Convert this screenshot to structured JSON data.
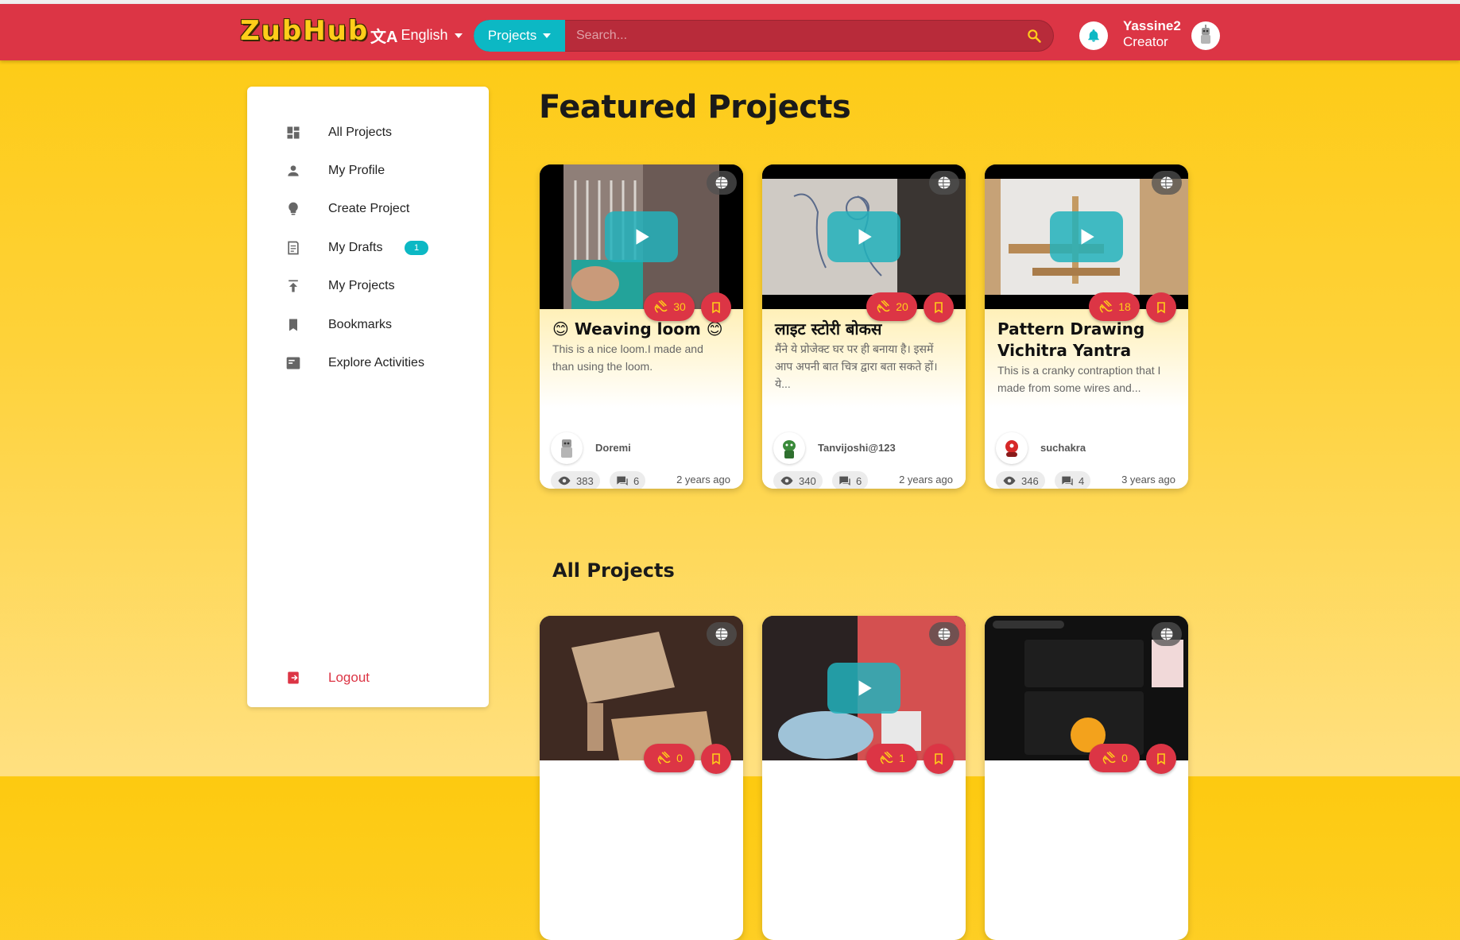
{
  "header": {
    "logo_text": "ZubHub",
    "language_label": "English",
    "search_category": "Projects",
    "search_placeholder": "Search...",
    "user_name": "Yassine2",
    "user_role": "Creator"
  },
  "sidebar": {
    "items": [
      {
        "label": "All Projects",
        "icon": "dashboard-icon"
      },
      {
        "label": "My Profile",
        "icon": "person-icon"
      },
      {
        "label": "Create Project",
        "icon": "lightbulb-icon"
      },
      {
        "label": "My Drafts",
        "icon": "drafts-icon",
        "badge": "1"
      },
      {
        "label": "My Projects",
        "icon": "publish-icon"
      },
      {
        "label": "Bookmarks",
        "icon": "bookmark-icon"
      },
      {
        "label": "Explore Activities",
        "icon": "activities-icon"
      }
    ],
    "logout_label": "Logout"
  },
  "main": {
    "featured_heading": "Featured Projects",
    "all_heading": "All Projects",
    "featured": [
      {
        "title": "😊 Weaving loom 😊",
        "description": "This is a nice loom.I made and than using the loom.",
        "claps": "30",
        "author": "Doremi",
        "views": "383",
        "comments": "6",
        "time": "2 years ago"
      },
      {
        "title": "लाइट स्टोरी बोकस",
        "description": "मैंने ये प्रोजेक्ट घर पर ही बनाया है। इसमें आप अपनी बात चित्र द्वारा बता सकते हों। ये...",
        "claps": "20",
        "author": "Tanvijoshi@123",
        "views": "340",
        "comments": "6",
        "time": "2 years ago"
      },
      {
        "title": "Pattern Drawing Vichitra Yantra",
        "description": "This is a cranky contraption that I made from some wires and...",
        "claps": "18",
        "author": "suchakra",
        "views": "346",
        "comments": "4",
        "time": "3 years ago"
      }
    ],
    "all": [
      {
        "claps": "0"
      },
      {
        "claps": "1"
      },
      {
        "claps": "0"
      }
    ]
  },
  "colors": {
    "header_red": "#dc3545",
    "accent_teal": "#0cb8c4",
    "background_yellow": "#fdca10"
  }
}
